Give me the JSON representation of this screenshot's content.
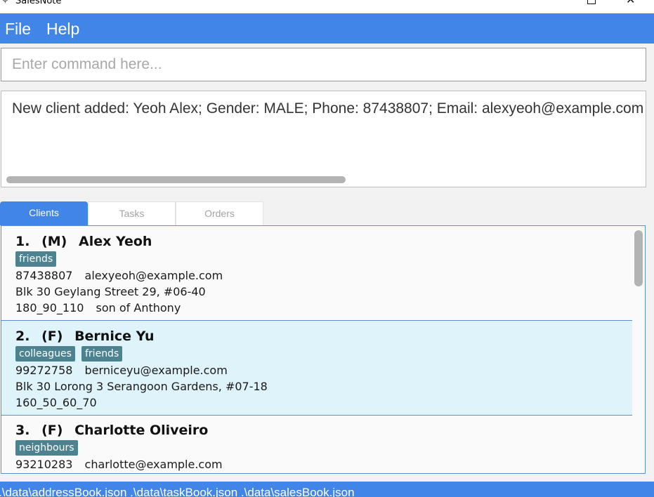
{
  "window": {
    "title": "SalesNote"
  },
  "menu": {
    "file": "File",
    "help": "Help"
  },
  "command": {
    "placeholder": "Enter command here...",
    "value": ""
  },
  "result": {
    "text": "New client added: Yeoh Alex; Gender: MALE; Phone: 87438807; Email: alexyeoh@example.com"
  },
  "tabs": [
    {
      "label": "Clients",
      "active": true
    },
    {
      "label": "Tasks",
      "active": false
    },
    {
      "label": "Orders",
      "active": false
    }
  ],
  "clients": [
    {
      "index": "1.",
      "gender": "(M)",
      "name": "Alex Yeoh",
      "tags": [
        "friends"
      ],
      "phone": "87438807",
      "email": "alexyeoh@example.com",
      "address": "Blk 30 Geylang Street 29, #06-40",
      "measurement": "180_90_110",
      "remark": "son of Anthony",
      "selected": false
    },
    {
      "index": "2.",
      "gender": "(F)",
      "name": "Bernice Yu",
      "tags": [
        "colleagues",
        "friends"
      ],
      "phone": "99272758",
      "email": "berniceyu@example.com",
      "address": "Blk 30 Lorong 3 Serangoon Gardens, #07-18",
      "measurement": "160_50_60_70",
      "remark": "",
      "selected": true
    },
    {
      "index": "3.",
      "gender": "(F)",
      "name": "Charlotte Oliveiro",
      "tags": [
        "neighbours"
      ],
      "phone": "93210283",
      "email": "charlotte@example.com",
      "selected": false
    }
  ],
  "status": {
    "text": ".\\data\\addressBook.json  .\\data\\taskBook.json  .\\data\\salesBook.json"
  },
  "colors": {
    "accent": "#4285e8",
    "tag": "#4d8291",
    "selected_row": "#dff3fb"
  }
}
